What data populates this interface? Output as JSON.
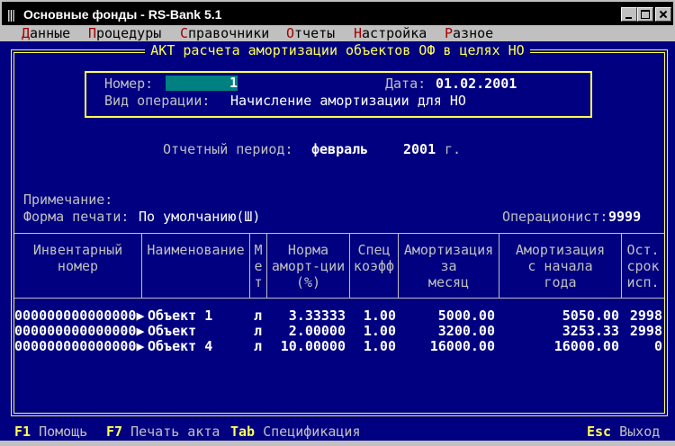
{
  "window": {
    "title": "Основные фонды - RS-Bank 5.1",
    "icon": "app-bars-icon"
  },
  "menu": [
    {
      "hot": "Д",
      "rest": "анные"
    },
    {
      "hot": "П",
      "rest": "роцедуры"
    },
    {
      "hot": "С",
      "rest": "правочники"
    },
    {
      "hot": "О",
      "rest": "тчеты"
    },
    {
      "hot": "Н",
      "rest": "астройка"
    },
    {
      "hot": "Р",
      "rest": "азное"
    }
  ],
  "dialog": {
    "title": "АКТ расчета амортизации объектов ОФ в целях НО",
    "number_label": "Номер:",
    "number_value": "1",
    "date_label": "Дата:",
    "date_value": "01.02.2001",
    "operation_label": "Вид операции:",
    "operation_value": "Начисление амортизации для НО",
    "period_label": "Отчетный период:",
    "period_month": "февраль",
    "period_year": "2001",
    "period_suffix": "г.",
    "note_label": "Примечание:",
    "print_form_label": "Форма печати:",
    "print_form_value": "По умолчанию(Ш)",
    "operator_label": "Операционист:",
    "operator_value": "9999"
  },
  "table": {
    "headers": {
      "inv": [
        "Инвентарный",
        "номер"
      ],
      "name": "Наименование",
      "method": [
        "М",
        "е",
        "т"
      ],
      "rate": [
        "Норма",
        "аморт-ции",
        "(%)"
      ],
      "coef": [
        "Спец",
        "коэфф"
      ],
      "month": [
        "Амортизация",
        "за",
        "месяц"
      ],
      "year": [
        "Амортизация",
        "с начала",
        "года"
      ],
      "rest": [
        "Ост.",
        "срок",
        "исп."
      ]
    },
    "rows": [
      {
        "inv": "000000000000000▶",
        "name": "Объект 1",
        "method": "л",
        "rate": "3.33333",
        "coef": "1.00",
        "month": "5000.00",
        "year": "5050.00",
        "rest": "2998"
      },
      {
        "inv": "000000000000000▶",
        "name": "Объект",
        "method": "л",
        "rate": "2.00000",
        "coef": "1.00",
        "month": "3200.00",
        "year": "3253.33",
        "rest": "2998"
      },
      {
        "inv": "000000000000000▶",
        "name": "Объект 4",
        "method": "л",
        "rate": "10.00000",
        "coef": "1.00",
        "month": "16000.00",
        "year": "16000.00",
        "rest": "0"
      }
    ]
  },
  "statusbar": {
    "f1_key": "F1",
    "f1_label": "Помощь",
    "f7_key": "F7",
    "f7_label": "Печать акта",
    "tab_key": "Tab",
    "tab_label": "Спецификация",
    "esc_key": "Esc",
    "esc_label": "Выход"
  },
  "colors": {
    "background": "#000080",
    "frame": "#ffff55",
    "field": "#008080",
    "label": "#c0c0c0",
    "value": "#ffffff",
    "hotkey": "#a00000"
  }
}
